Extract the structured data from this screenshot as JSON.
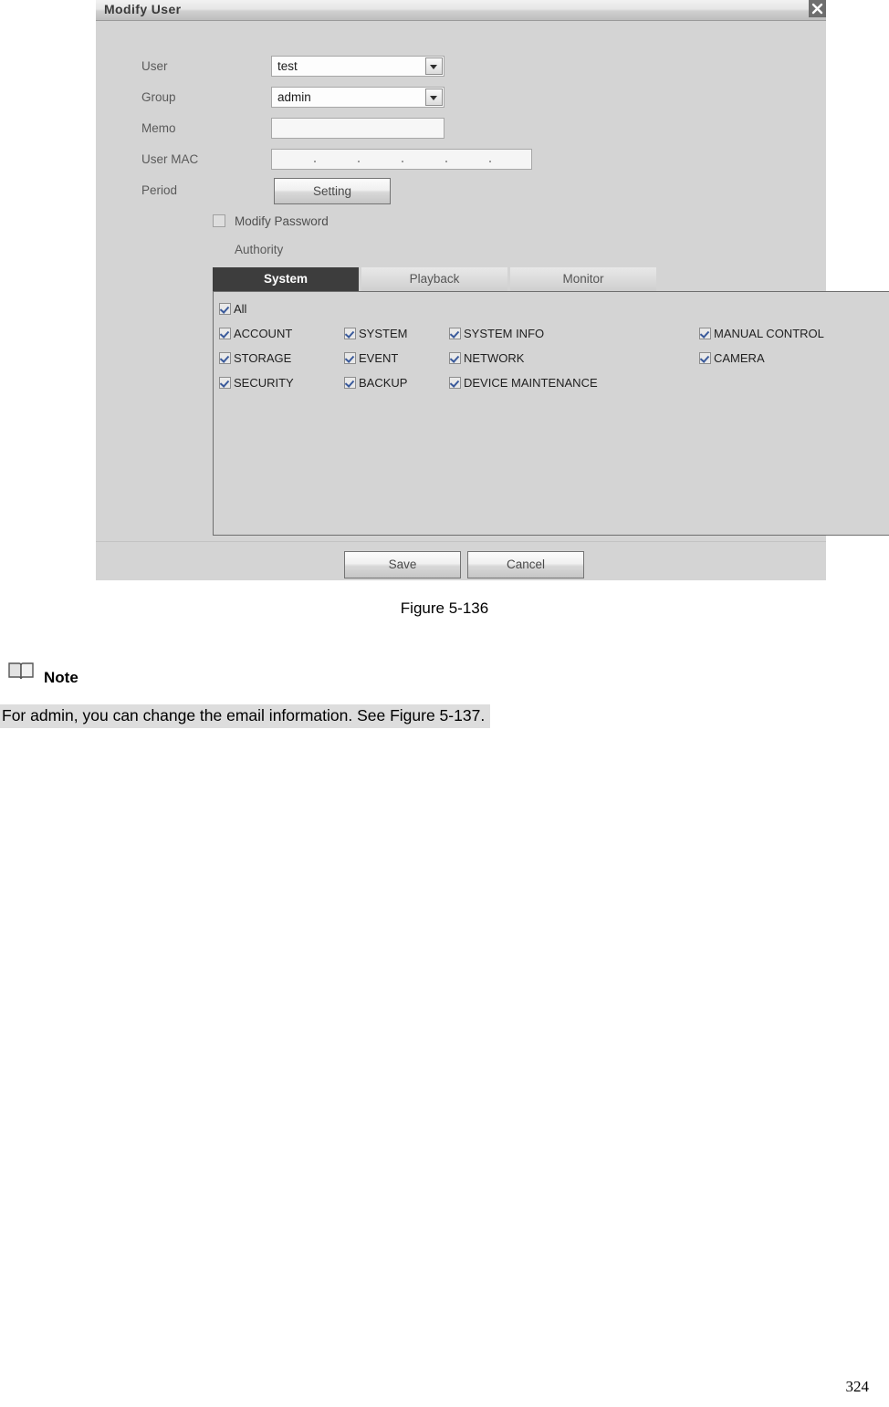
{
  "dialog": {
    "title": "Modify User",
    "close_icon": "close-icon",
    "fields": [
      {
        "label": "User",
        "type": "combo",
        "value": "test",
        "name": "user"
      },
      {
        "label": "Group",
        "type": "combo",
        "value": "admin",
        "name": "group"
      },
      {
        "label": "Memo",
        "type": "text",
        "value": "",
        "name": "memo"
      },
      {
        "label": "User MAC",
        "type": "mac",
        "value": "",
        "name": "user-mac"
      },
      {
        "label": "Period",
        "type": "button",
        "value": "Setting",
        "name": "period"
      }
    ],
    "period_button_label": "Setting",
    "modify_password": {
      "label": "Modify Password",
      "checked": false
    },
    "authority_label": "Authority",
    "tabs": [
      {
        "label": "System",
        "active": true
      },
      {
        "label": "Playback",
        "active": false
      },
      {
        "label": "Monitor",
        "active": false
      }
    ],
    "authority": {
      "all": {
        "label": "All",
        "checked": true
      },
      "columns": [
        [
          {
            "label": "ACCOUNT",
            "checked": true
          },
          {
            "label": "STORAGE",
            "checked": true
          },
          {
            "label": "SECURITY",
            "checked": true
          }
        ],
        [
          {
            "label": "SYSTEM",
            "checked": true
          },
          {
            "label": "EVENT",
            "checked": true
          },
          {
            "label": "BACKUP",
            "checked": true
          }
        ],
        [
          {
            "label": "SYSTEM INFO",
            "checked": true
          },
          {
            "label": "NETWORK",
            "checked": true
          },
          {
            "label": "DEVICE MAINTENANCE",
            "checked": true
          }
        ],
        [
          {
            "label": "MANUAL CONTROL",
            "checked": true
          },
          {
            "label": "CAMERA",
            "checked": true
          }
        ]
      ]
    },
    "footer": {
      "save_label": "Save",
      "cancel_label": "Cancel"
    }
  },
  "document": {
    "figure_caption": "Figure 5-136",
    "note_heading": "Note",
    "note_icon": "book-icon",
    "note_body": "For admin, you can change the email information. See Figure 5-137.",
    "page_number": "324"
  },
  "colors": {
    "dialog_background": "#d4d4d4",
    "active_tab": "#3d3d3d",
    "checkmark": "#3a5a9b",
    "close_button": "#6e6e6e",
    "note_highlight": "#dddddd"
  }
}
